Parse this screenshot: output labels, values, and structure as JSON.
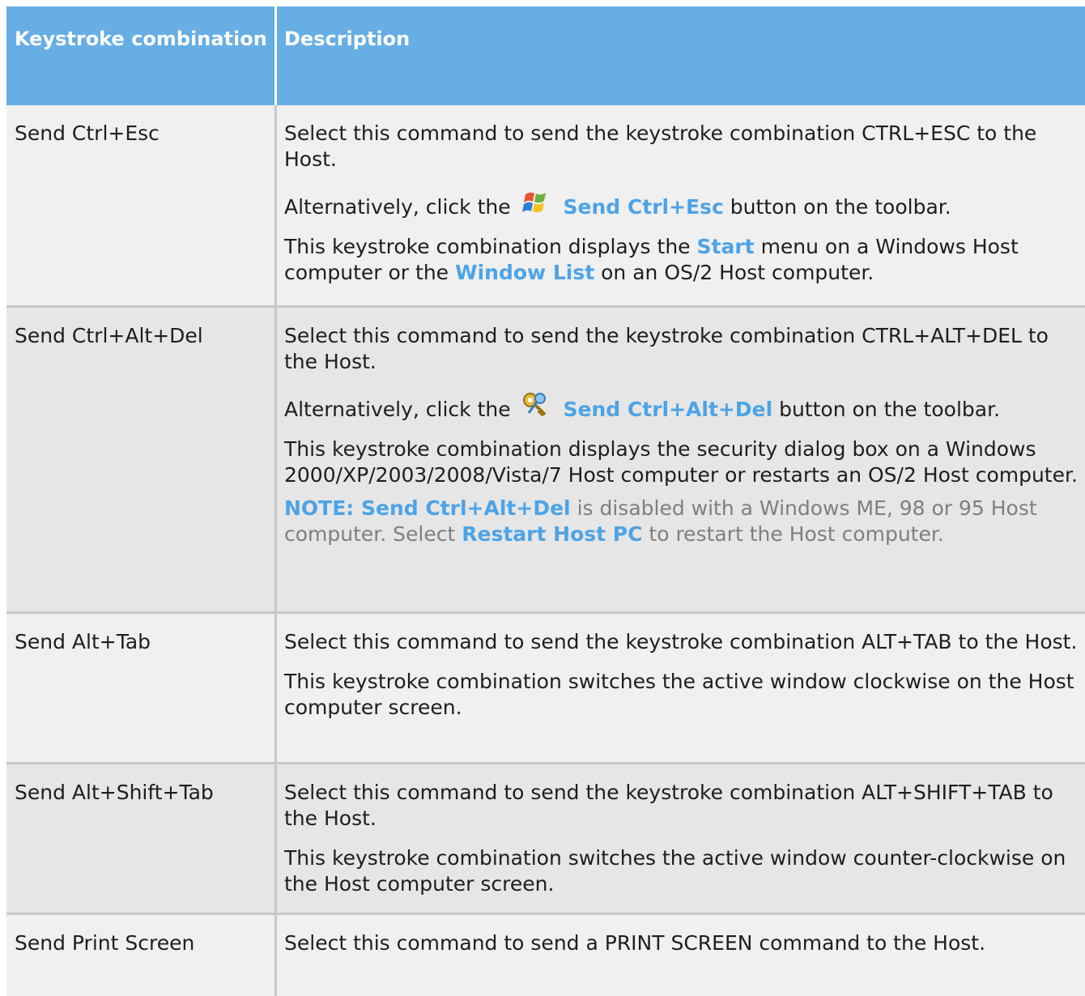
{
  "header": {
    "col1": "Keystroke combination",
    "col2": "Description"
  },
  "rows": [
    {
      "key": "Send Ctrl+Esc",
      "desc1": "Select this command to send the keystroke combination CTRL+ESC to the Host.",
      "alt_prefix": "Alternatively, click the",
      "alt_button": "Send Ctrl+Esc",
      "alt_suffix": "button on the toolbar.",
      "alt_icon": "windows-start-icon",
      "d3_a": "This keystroke combination displays the",
      "d3_b": "Start",
      "d3_c": "menu on a Windows Host computer or the",
      "d3_d": "Window List",
      "d3_e": "on an OS/2 Host computer."
    },
    {
      "key": "Send Ctrl+Alt+Del",
      "desc1": "Select this command to send the keystroke combination CTRL+ALT+DEL to the Host.",
      "alt_prefix": "Alternatively, click the",
      "alt_button": "Send Ctrl+Alt+Del",
      "alt_suffix": "button on the toolbar.",
      "alt_icon": "keys-icon",
      "desc3": "This keystroke combination displays the security dialog box on a Windows 2000/XP/2003/2008/Vista/7 Host computer or restarts an OS/2 Host computer.",
      "note_label": "NOTE: Send Ctrl+Alt+Del",
      "note_a": "is disabled with a Windows ME, 98 or 95 Host computer. Select",
      "note_b": "Restart Host PC",
      "note_c": "to restart the Host computer."
    },
    {
      "key": "Send Alt+Tab",
      "desc1": "Select this command to send the keystroke combination ALT+TAB to the Host.",
      "desc2": "This keystroke combination switches the active window clockwise on the Host computer screen."
    },
    {
      "key": "Send Alt+Shift+Tab",
      "desc1": "Select this command to send the keystroke combination ALT+SHIFT+TAB to the Host.",
      "desc2": "This keystroke combination switches the active window counter-clockwise on the Host computer screen."
    },
    {
      "key": "Send Print Screen",
      "desc1": "Select this command to send a PRINT SCREEN command to the Host."
    }
  ],
  "colors": {
    "header_bg": "#66aee4",
    "link": "#4da3e6",
    "note_text": "#7f7f7f",
    "row_light": "#f0f0f0",
    "row_dark": "#e6e6e6"
  }
}
